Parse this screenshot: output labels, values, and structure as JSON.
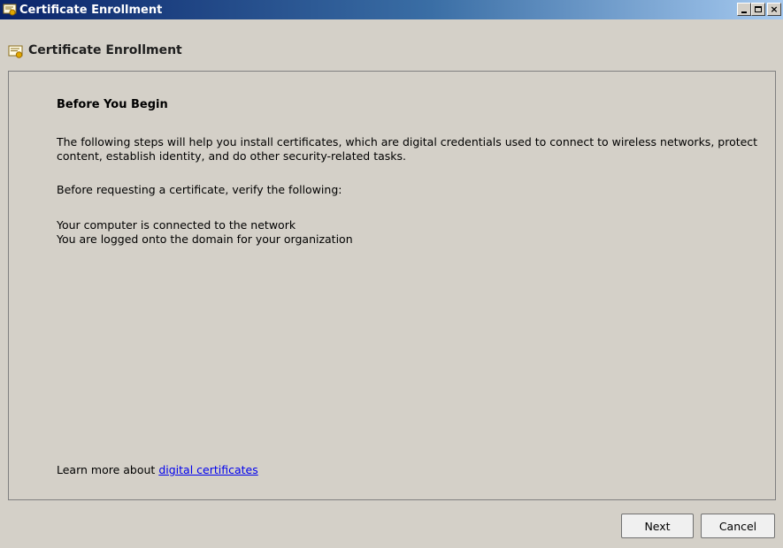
{
  "window": {
    "title": "Certificate Enrollment",
    "controls": {
      "minimize": "_",
      "maximize": "□",
      "close": "×"
    }
  },
  "header": {
    "title": "Certificate Enrollment",
    "icon": "certificate-icon"
  },
  "content": {
    "section_title": "Before You Begin",
    "intro": "The following steps will help you install certificates, which are digital credentials used to connect to wireless networks, protect content, establish identity, and do other security-related tasks.",
    "verify_prompt": "Before requesting a certificate, verify the following:",
    "checks": [
      "Your computer is connected to the network",
      "You are logged onto the domain for your organization"
    ],
    "learn_more_prefix": "Learn more about ",
    "learn_more_link": "digital certificates"
  },
  "buttons": {
    "next": "Next",
    "cancel": "Cancel"
  }
}
